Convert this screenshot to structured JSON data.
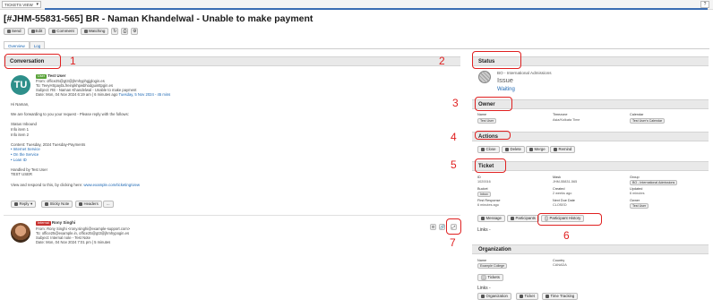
{
  "topbar": {
    "select_value": "TICKETS VIEW",
    "help_label": "?"
  },
  "title": "[#JHM-55831-565] BR - Naman Khandelwal - Unable to make payment",
  "toolbar": [
    {
      "label": "Send",
      "icon": "send-icon"
    },
    {
      "label": "Edit",
      "icon": "edit-icon"
    },
    {
      "label": "Comment",
      "icon": "comment-icon"
    },
    {
      "label": "Watching",
      "icon": "eye-icon"
    }
  ],
  "tabs": [
    "Overview",
    "Log"
  ],
  "sections": {
    "conversation": "Conversation",
    "status": "Status",
    "owner": "Owner",
    "actions": "Actions",
    "ticket": "Ticket",
    "organization": "Organization"
  },
  "annotations": [
    "1",
    "2",
    "3",
    "4",
    "5",
    "6",
    "7"
  ],
  "message1": {
    "avatar": "TU",
    "badge": "User",
    "sender": "Test User",
    "lines": [
      "From: office25@gt3@jhmhyphgjglogin.es",
      "To: TeeyHSpaybLfreinpkhpwbhodguinttpgin.es",
      "Subject: RE - Naman Khandelwal - Unable to make payment",
      "Date: Mon, 04 Nov 2024 6:19 am | 6 minutes ago"
    ],
    "date_link": "Tuesday, 5 Nov 2024 - 45 mins",
    "body": [
      "Hi Naman,",
      "",
      "We are forwarding to you your request - Please reply with the follows:",
      "",
      "Status Inbound",
      "Info item 1",
      "Info item 2",
      "",
      "Content: Tuesday, 2024 Tuesday-Payments",
      "• Internet Service",
      "• On the Service",
      "• Loan ID",
      "",
      "Handled by Test User",
      "TEST USER",
      ""
    ],
    "footer_text": "View and respond to this, by clicking here:",
    "footer_link": "www.example.com/ticketing/view"
  },
  "message1_actions": [
    "Reply",
    "Sticky Note",
    "Headers",
    "..."
  ],
  "message2": {
    "badge": "Internal",
    "sender": "Rony Singhi",
    "lines": [
      "From: Rony Singhi <rony.singhi@example-support.com>",
      "To: office25@example.in, office25@gt3@jhmhypogin.es",
      "Subject: Internal note - Test Note",
      "Date: Mon, 04 Nov 2024 7:01 pm | 5 minutes"
    ]
  },
  "status": {
    "department": "BO - International Admissions",
    "type": "Issue",
    "state": "Waiting"
  },
  "owner": {
    "fields": [
      {
        "label": "Name",
        "value": "Test User"
      },
      {
        "label": "Timezone",
        "value": "Asia/Kolkata Time"
      },
      {
        "label": "Calendar",
        "value": "Test User's Calendar"
      }
    ]
  },
  "actions": [
    {
      "label": "Close",
      "icon": "check-icon"
    },
    {
      "label": "Delete",
      "icon": "trash-icon"
    },
    {
      "label": "Merge",
      "icon": "merge-icon"
    },
    {
      "label": "Remind",
      "icon": "bell-icon"
    }
  ],
  "ticket": {
    "fields": [
      {
        "label": "ID",
        "value": "1020016"
      },
      {
        "label": "Mask",
        "value": "JHM-55831-565"
      },
      {
        "label": "Group",
        "value": "BO - International Admissions"
      },
      {
        "label": "Bucket",
        "value": "Inbox"
      },
      {
        "label": "Created",
        "value": "2 weeks ago"
      },
      {
        "label": "Updated",
        "value": "6 minutes"
      },
      {
        "label": "First Response",
        "value": "6 minutes ago"
      },
      {
        "label": "Next Due Date",
        "value": "CLOSED"
      },
      {
        "label": "Owner",
        "value": "Test User"
      }
    ],
    "buttons": [
      {
        "label": "Message",
        "count": ""
      },
      {
        "label": "Participants",
        "count": ""
      },
      {
        "label": "Participant History",
        "count": "2"
      }
    ],
    "links_label": "Links -"
  },
  "organization": {
    "fields": [
      {
        "label": "Name",
        "value": "Example College"
      },
      {
        "label": "Country",
        "value": "CANADA"
      }
    ],
    "tickets_button": {
      "label": "Tickets",
      "count": "22"
    },
    "links_label": "Links -",
    "buttons": [
      {
        "label": "Organization",
        "count": ""
      },
      {
        "label": "Ticket",
        "count": ""
      },
      {
        "label": "Time Tracking",
        "count": ""
      }
    ]
  }
}
